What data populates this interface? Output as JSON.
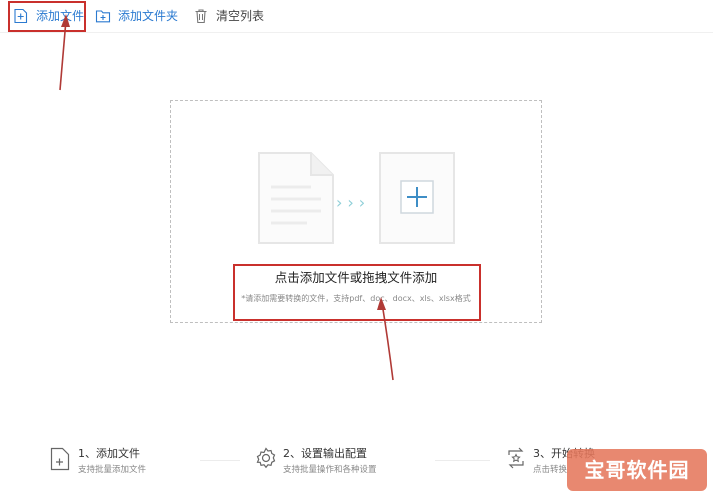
{
  "toolbar": {
    "add_file": "添加文件",
    "add_folder": "添加文件夹",
    "clear_list": "清空列表"
  },
  "dropzone": {
    "title": "点击添加文件或拖拽文件添加",
    "hint": "*请添加需要转换的文件，支持pdf、doc、docx、xls、xlsx格式"
  },
  "steps": [
    {
      "title": "1、添加文件",
      "subtitle": "支持批量添加文件",
      "icon": "file-add-icon"
    },
    {
      "title": "2、设置输出配置",
      "subtitle": "支持批量操作和各种设置",
      "icon": "gear-icon"
    },
    {
      "title": "3、开始转换",
      "subtitle": "点击转换",
      "icon": "convert-icon"
    }
  ],
  "watermark": "宝哥软件园",
  "colors": {
    "accent": "#2b7ad0",
    "highlight": "#c9302c",
    "watermark_bg": "#e5785c",
    "chevron": "#8fcfd8"
  }
}
